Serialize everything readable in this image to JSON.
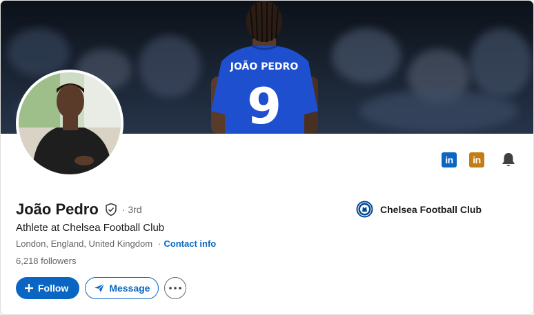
{
  "profile": {
    "name": "João Pedro",
    "degree": "· 3rd",
    "headline": "Athlete at Chelsea Football Club",
    "location": "London, England, United Kingdom",
    "contact_label": "Contact info",
    "followers": "6,218 followers",
    "jersey_name": "JOÃO PEDRO",
    "jersey_number": "9"
  },
  "company": {
    "name": "Chelsea Football Club"
  },
  "actions": {
    "follow_label": "Follow",
    "message_label": "Message"
  },
  "icons": {
    "linkedin_blue": "linkedin-icon",
    "linkedin_gold": "linkedin-premium-icon",
    "bell": "bell-icon",
    "verified": "verified-shield-icon",
    "more": "more-horizontal-icon"
  },
  "colors": {
    "accent": "#0a66c2",
    "linkedin_blue": "#0a66c2",
    "linkedin_gold": "#c37d16",
    "jersey_blue": "#1e4fcf"
  }
}
